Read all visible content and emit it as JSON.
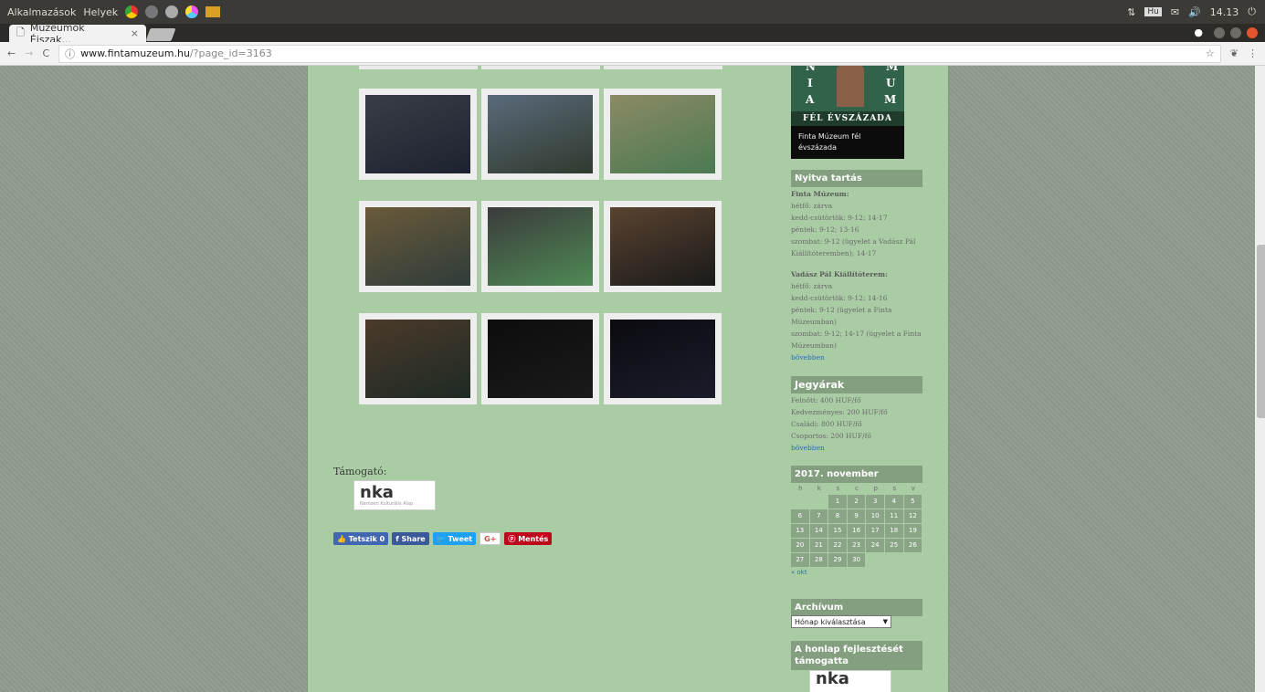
{
  "os_panel": {
    "apps_label": "Alkalmazások",
    "places_label": "Helyek",
    "keyboard": "Hu",
    "clock": "14.13"
  },
  "browser": {
    "tab_title": "Múzeumok Éjszak...",
    "tab_close": "×",
    "url_host": "www.fintamuzeum.hu",
    "url_path": "/?page_id=3163"
  },
  "gallery": {
    "photos": [
      {
        "desc": "night-outdoor-pavilion",
        "colors": [
          "#3a3d45",
          "#1d2230"
        ]
      },
      {
        "desc": "courtyard-crowd",
        "colors": [
          "#5a6a7b",
          "#2f3a2d"
        ]
      },
      {
        "desc": "exhibition-room-visitors",
        "colors": [
          "#8b8a64",
          "#4b7a52"
        ]
      },
      {
        "desc": "family-at-exhibit",
        "colors": [
          "#6a5a3a",
          "#2f3c3a"
        ]
      },
      {
        "desc": "museum-hall-green-model",
        "colors": [
          "#3b3b3b",
          "#4f8a55"
        ]
      },
      {
        "desc": "lit-pavilion-night",
        "colors": [
          "#5a4330",
          "#1a1a1a"
        ]
      },
      {
        "desc": "guide-with-book",
        "colors": [
          "#4b3a2a",
          "#1e2a24"
        ]
      },
      {
        "desc": "dark-table-glow",
        "colors": [
          "#0d0d0d",
          "#1a1a1a"
        ]
      },
      {
        "desc": "dark-window-light",
        "colors": [
          "#0b0b10",
          "#1a1c2a"
        ]
      }
    ]
  },
  "footer": {
    "supporter_label": "Támogató:",
    "nka_logo": "nka",
    "nka_sub": "Nemzeti Kulturális Alap"
  },
  "share": {
    "like": "Tetszik 0",
    "share": "Share",
    "tweet": "Tweet",
    "gplus": "G+",
    "save": "Mentés"
  },
  "sidebar": {
    "badge_letters": [
      "N",
      "M",
      "I",
      "U",
      "A",
      "M"
    ],
    "badge_band": "FÉL ÉVSZÁZADA",
    "badge_caption": "Finta Múzeum fél évszázada",
    "opening_title": "Nyitva tartás",
    "opening": {
      "finta_heading": "Finta Múzeum:",
      "finta_lines": [
        "hétfő: zárva",
        "kedd-csütörtök: 9-12; 14-17",
        "péntek: 9-12; 13-16",
        "szombat: 9-12 (ügyelet a Vadász Pál",
        "Kiállítóteremben); 14-17"
      ],
      "vadasz_heading": "Vadász Pál Kiállítóterem:",
      "vadasz_lines": [
        "hétfő: zárva",
        "kedd-csütörtök: 9-12; 14-16",
        "péntek: 9-12 (ügyelet a Finta",
        "Múzeumban)",
        "szombat: 9-12; 14-17 (ügyelet a Finta",
        "Múzeumban)"
      ],
      "more": "bővebben"
    },
    "tickets_title": "Jegyárak",
    "tickets": [
      "Felnőtt: 400 HUF/fő",
      "Kedvezményes: 200 HUF/fő",
      "Családi: 800 HUF/fő",
      "Csoportos: 200 HUF/fő"
    ],
    "tickets_more": "bővebben",
    "calendar_title": "2017. november",
    "calendar_days": [
      "h",
      "k",
      "s",
      "c",
      "p",
      "s",
      "v"
    ],
    "calendar_weeks": [
      [
        "",
        "",
        "1",
        "2",
        "3",
        "4",
        "5"
      ],
      [
        "6",
        "7",
        "8",
        "9",
        "10",
        "11",
        "12"
      ],
      [
        "13",
        "14",
        "15",
        "16",
        "17",
        "18",
        "19"
      ],
      [
        "20",
        "21",
        "22",
        "23",
        "24",
        "25",
        "26"
      ],
      [
        "27",
        "28",
        "29",
        "30",
        "",
        "",
        ""
      ]
    ],
    "calendar_prev": "« okt",
    "archive_title": "Archívum",
    "archive_select": "Hónap kiválasztása",
    "dev_title": "A honlap fejlesztését támogatta",
    "dev_logo": "nka"
  }
}
